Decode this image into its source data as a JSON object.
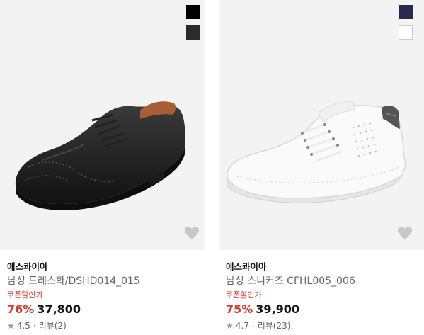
{
  "products": [
    {
      "brand": "에스콰이아",
      "name": "남성 드레스화/DSHD014_015",
      "coupon_label": "쿠폰할인가",
      "discount": "76%",
      "price": "37,800",
      "rating": "4.5",
      "reviews": "리뷰(2)",
      "swatches": [
        "#000000",
        "#2b2b2b"
      ]
    },
    {
      "brand": "에스콰이아",
      "name": "남성 스니커즈 CFHL005_006",
      "coupon_label": "쿠폰할인가",
      "discount": "75%",
      "price": "39,900",
      "rating": "4.7",
      "reviews": "리뷰(23)",
      "swatches": [
        "#2a2a4e",
        "#ffffff"
      ]
    }
  ],
  "icons": {
    "heart": "heart-icon",
    "star": "star-icon"
  },
  "colors": {
    "accent_red": "#d83a2d",
    "image_bg": "#f3f3f3"
  }
}
